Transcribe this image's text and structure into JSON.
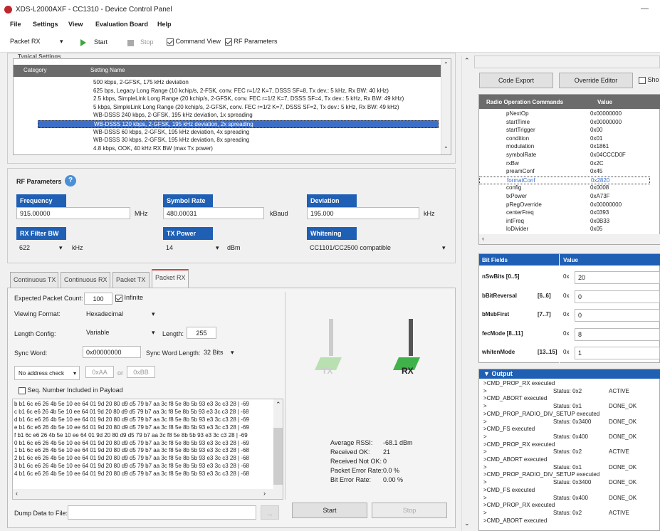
{
  "window": {
    "title": "XDS-L2000AXF - CC1310 - Device Control Panel",
    "minimize": "—"
  },
  "menu": [
    "File",
    "Settings",
    "View",
    "Evaluation Board",
    "Help"
  ],
  "toolbar": {
    "mode": "Packet RX",
    "start": "Start",
    "stop": "Stop",
    "command_view": "Command View",
    "rf_parameters": "RF Parameters"
  },
  "settings": {
    "header_partial": "Typical Settings",
    "col_category": "Category",
    "col_name": "Setting Name",
    "rows": [
      "500 kbps, 2-GFSK, 175 kHz deviation",
      "625 bps, Legacy Long Range (10 kchip/s, 2-FSK, conv. FEC r=1/2 K=7, DSSS SF=8, Tx dev.: 5 kHz, Rx BW: 40 kHz)",
      "2.5 kbps, SimpleLink Long Range (20 kchip/s, 2-GFSK, conv. FEC r=1/2 K=7, DSSS SF=4, Tx dev.: 5 kHz, Rx BW: 49 kHz)",
      "5 kbps, SimpleLink Long Range (20 kchip/s, 2-GFSK, conv. FEC r=1/2 K=7, DSSS SF=2, Tx dev.: 5 kHz, Rx BW: 49 kHz)",
      "WB-DSSS 240 kbps, 2-GFSK, 195 kHz deviation, 1x spreading",
      "WB-DSSS 120 kbps, 2-GFSK, 195 kHz deviation, 2x spreading",
      "WB-DSSS 60 kbps, 2-GFSK, 195 kHz deviation, 4x spreading",
      "WB-DSSS 30 kbps, 2-GFSK, 195 kHz deviation, 8x spreading",
      "4.8 kbps, OOK, 40 kHz RX BW (max Tx power)"
    ],
    "selected_index": 5
  },
  "rf": {
    "title": "RF Parameters",
    "help": "?",
    "frequency": {
      "label": "Frequency",
      "value": "915.00000",
      "unit": "MHz"
    },
    "symbol_rate": {
      "label": "Symbol Rate",
      "value": "480.00031",
      "unit": "kBaud"
    },
    "deviation": {
      "label": "Deviation",
      "value": "195.000",
      "unit": "kHz"
    },
    "rx_filter_bw": {
      "label": "RX Filter BW",
      "value": "622",
      "unit": "kHz"
    },
    "tx_power": {
      "label": "TX Power",
      "value": "14",
      "unit": "dBm"
    },
    "whitening": {
      "label": "Whitening",
      "value": "CC1101/CC2500 compatible"
    }
  },
  "tabs": [
    "Continuous TX",
    "Continuous RX",
    "Packet TX",
    "Packet RX"
  ],
  "packet_rx": {
    "expected_count_label": "Expected Packet Count:",
    "expected_count": "100",
    "infinite": "Infinite",
    "viewing_format_label": "Viewing Format:",
    "viewing_format": "Hexadecimal",
    "length_config_label": "Length Config:",
    "length_config": "Variable",
    "length_label": "Length:",
    "length": "255",
    "sync_word_label": "Sync Word:",
    "sync_word": "0x00000000",
    "sync_len_label": "Sync Word Length:",
    "sync_len": "32 Bits",
    "address_check": "No address check",
    "addr1": "0xAA",
    "or": "or",
    "addr2": "0xBB",
    "seq_label": "Seq. Number Included in Payload",
    "data_lines": [
      "b b1 6c e6 26 4b 5e 10 ee 64 01 9d 20 80 d9 d5 79 b7 aa 3c f8 5e 8b 5b 93 e3 3c c3 28  |  -69",
      "c b1 6c e6 26 4b 5e 10 ee 64 01 9d 20 80 d9 d5 79 b7 aa 3c f8 5e 8b 5b 93 e3 3c c3 28  |  -68",
      "d b1 6c e6 26 4b 5e 10 ee 64 01 9d 20 80 d9 d5 79 b7 aa 3c f8 5e 8b 5b 93 e3 3c c3 28  |  -69",
      "e b1 6c e6 26 4b 5e 10 ee 64 01 9d 20 80 d9 d5 79 b7 aa 3c f8 5e 8b 5b 93 e3 3c c3 28  |  -69",
      "f b1 6c e6 26 4b 5e 10 ee 64 01 9d 20 80 d9 d5 79 b7 aa 3c f8 5e 8b 5b 93 e3 3c c3 28  |  -69",
      "0 b1 6c e6 26 4b 5e 10 ee 64 01 9d 20 80 d9 d5 79 b7 aa 3c f8 5e 8b 5b 93 e3 3c c3 28  |  -69",
      "1 b1 6c e6 26 4b 5e 10 ee 64 01 9d 20 80 d9 d5 79 b7 aa 3c f8 5e 8b 5b 93 e3 3c c3 28  |  -68",
      "2 b1 6c e6 26 4b 5e 10 ee 64 01 9d 20 80 d9 d5 79 b7 aa 3c f8 5e 8b 5b 93 e3 3c c3 28  |  -68",
      "3 b1 6c e6 26 4b 5e 10 ee 64 01 9d 20 80 d9 d5 79 b7 aa 3c f8 5e 8b 5b 93 e3 3c c3 28  |  -68",
      "4 b1 6c e6 26 4b 5e 10 ee 64 01 9d 20 80 d9 d5 79 b7 aa 3c f8 5e 8b 5b 93 e3 3c c3 28  |  -68"
    ],
    "dump_label": "Dump Data to File:",
    "browse": "...",
    "tx_label": "TX",
    "rx_label": "RX",
    "stats": [
      {
        "label": "Average RSSI:",
        "value": "-68.1 dBm"
      },
      {
        "label": "Received OK:",
        "value": "21"
      },
      {
        "label": "Received Not OK:",
        "value": "0"
      },
      {
        "label": "Packet Error Rate:",
        "value": "0.0 %"
      },
      {
        "label": "Bit Error Rate:",
        "value": "0.00 %"
      }
    ],
    "start": "Start",
    "stop": "Stop"
  },
  "right": {
    "code_export": "Code Export",
    "override_editor": "Override Editor",
    "show_partial": "Sho",
    "cmd_header": "Radio Operation Commands",
    "value_header": "Value",
    "cmds": [
      [
        "pNextOp",
        "0x00000000"
      ],
      [
        "startTime",
        "0x00000000"
      ],
      [
        "startTrigger",
        "0x00"
      ],
      [
        "condition",
        "0x01"
      ],
      [
        "modulation",
        "0x1861"
      ],
      [
        "symbolRate",
        "0x04CCCD0F"
      ],
      [
        "rxBw",
        "0x2C"
      ],
      [
        "preamConf",
        "0x45"
      ],
      [
        "formatConf",
        "0x2820"
      ],
      [
        "config",
        "0x0008"
      ],
      [
        "txPower",
        "0xA73F"
      ],
      [
        "pRegOverride",
        "0x00000000"
      ],
      [
        "centerFreq",
        "0x0393"
      ],
      [
        "intFreq",
        "0x0B33"
      ],
      [
        "loDivider",
        "0x05"
      ]
    ],
    "selected_cmd": 8,
    "bit_header": "Bit Fields",
    "bit_value_header": "Value",
    "bits": [
      {
        "name": "nSwBits  [0..5]",
        "range": "",
        "prefix": "0x",
        "value": "20"
      },
      {
        "name": "bBitReversal",
        "range": "[6..6]",
        "prefix": "0x",
        "value": "0"
      },
      {
        "name": "bMsbFirst",
        "range": "[7..7]",
        "prefix": "0x",
        "value": "0"
      },
      {
        "name": "fecMode  [8..11]",
        "range": "",
        "prefix": "0x",
        "value": "8"
      },
      {
        "name": "whitenMode",
        "range": "[13..15]",
        "prefix": "0x",
        "value": "1"
      }
    ],
    "output_header": "Output",
    "output": [
      [
        ">CMD_PROP_RX executed",
        "",
        ""
      ],
      [
        ">",
        "Status: 0x2",
        "ACTIVE"
      ],
      [
        ">CMD_ABORT executed",
        "",
        ""
      ],
      [
        ">",
        "Status: 0x1",
        "DONE_OK"
      ],
      [
        ">CMD_PROP_RADIO_DIV_SETUP executed",
        "",
        ""
      ],
      [
        ">",
        "Status: 0x3400",
        "DONE_OK"
      ],
      [
        ">CMD_FS executed",
        "",
        ""
      ],
      [
        ">",
        "Status: 0x400",
        "DONE_OK"
      ],
      [
        ">CMD_PROP_RX executed",
        "",
        ""
      ],
      [
        ">",
        "Status: 0x2",
        "ACTIVE"
      ],
      [
        ">CMD_ABORT executed",
        "",
        ""
      ],
      [
        ">",
        "Status: 0x1",
        "DONE_OK"
      ],
      [
        ">CMD_PROP_RADIO_DIV_SETUP executed",
        "",
        ""
      ],
      [
        ">",
        "Status: 0x3400",
        "DONE_OK"
      ],
      [
        ">CMD_FS executed",
        "",
        ""
      ],
      [
        ">",
        "Status: 0x400",
        "DONE_OK"
      ],
      [
        ">CMD_PROP_RX executed",
        "",
        ""
      ],
      [
        ">",
        "Status: 0x2",
        "ACTIVE"
      ],
      [
        ">CMD_ABORT executed",
        "",
        ""
      ]
    ]
  }
}
